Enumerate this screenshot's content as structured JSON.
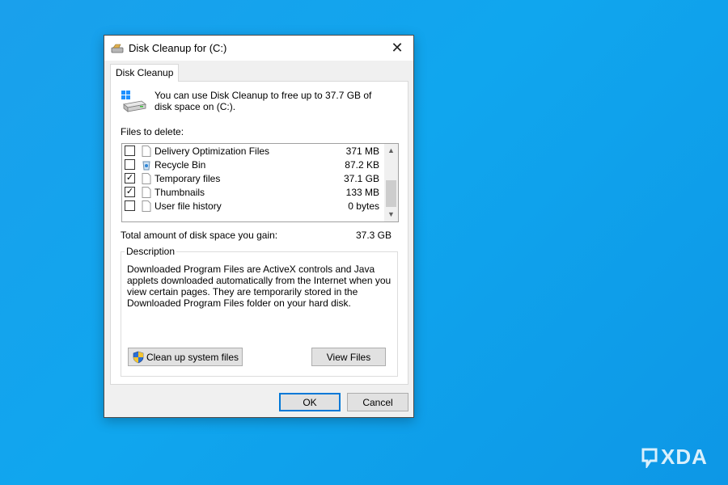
{
  "window": {
    "title": "Disk Cleanup for  (C:)",
    "close_glyph": "✕",
    "icons": {
      "app": "disk-cleanup-icon",
      "drive": "drive-icon"
    }
  },
  "tab": {
    "label": "Disk Cleanup"
  },
  "header": {
    "text": "You can use Disk Cleanup to free up to 37.7 GB of disk space on  (C:)."
  },
  "files": {
    "label": "Files to delete:",
    "items": [
      {
        "name": "Delivery Optimization Files",
        "size": "371 MB",
        "checked": false,
        "icon": "file-icon"
      },
      {
        "name": "Recycle Bin",
        "size": "87.2 KB",
        "checked": false,
        "icon": "recycle-bin-icon"
      },
      {
        "name": "Temporary files",
        "size": "37.1 GB",
        "checked": true,
        "icon": "file-icon"
      },
      {
        "name": "Thumbnails",
        "size": "133 MB",
        "checked": true,
        "icon": "file-icon"
      },
      {
        "name": "User file history",
        "size": "0 bytes",
        "checked": false,
        "icon": "file-icon"
      }
    ],
    "check_glyph": "✓"
  },
  "total": {
    "label": "Total amount of disk space you gain:",
    "value": "37.3 GB"
  },
  "description": {
    "legend": "Description",
    "text": "Downloaded Program Files are ActiveX controls and Java applets downloaded automatically from the Internet when you view certain pages. They are temporarily stored in the Downloaded Program Files folder on your hard disk."
  },
  "buttons": {
    "cleanup": "Clean up system files",
    "view_files": "View Files",
    "ok": "OK",
    "cancel": "Cancel"
  },
  "watermark": {
    "text": "XDA"
  },
  "colors": {
    "desktop": "#1aa0ec",
    "accent": "#0078d7"
  }
}
